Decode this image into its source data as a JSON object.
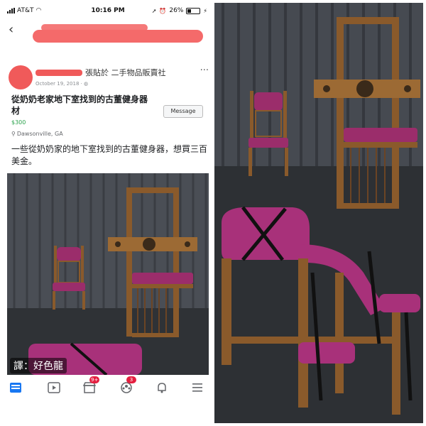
{
  "status_bar": {
    "carrier": "AT&T",
    "time": "10:16 PM",
    "battery": "26%",
    "icons": [
      "signal-icon",
      "wifi-icon",
      "location-arrow-icon",
      "alarm-icon",
      "battery-icon",
      "charging-icon"
    ]
  },
  "nav": {
    "back_icon": "chevron-left-icon"
  },
  "post": {
    "posted_in": "張貼於 二手物品販賣社",
    "more": "···",
    "date": "October 19, 2018 · ",
    "title": "從奶奶老家地下室找到的古董健身器材",
    "price": "$300",
    "location": "Dawsonville, GA",
    "message_button": "Message",
    "description": "一些從奶奶家的地下室找到的古董健身器，想買三百美金。"
  },
  "watermark": "譯：好色龍",
  "tab_bar": {
    "tabs": [
      {
        "name": "news-feed-icon",
        "badge": ""
      },
      {
        "name": "video-icon",
        "badge": ""
      },
      {
        "name": "marketplace-icon",
        "badge": "9+"
      },
      {
        "name": "groups-icon",
        "badge": "3"
      },
      {
        "name": "notifications-icon",
        "badge": ""
      },
      {
        "name": "menu-icon",
        "badge": ""
      }
    ]
  },
  "colors": {
    "accent": "#1877f2",
    "price_green": "#2ba24c",
    "badge_red": "#e41e3f",
    "leather_purple": "#9b2d6b",
    "wood": "#8a5a2b"
  }
}
